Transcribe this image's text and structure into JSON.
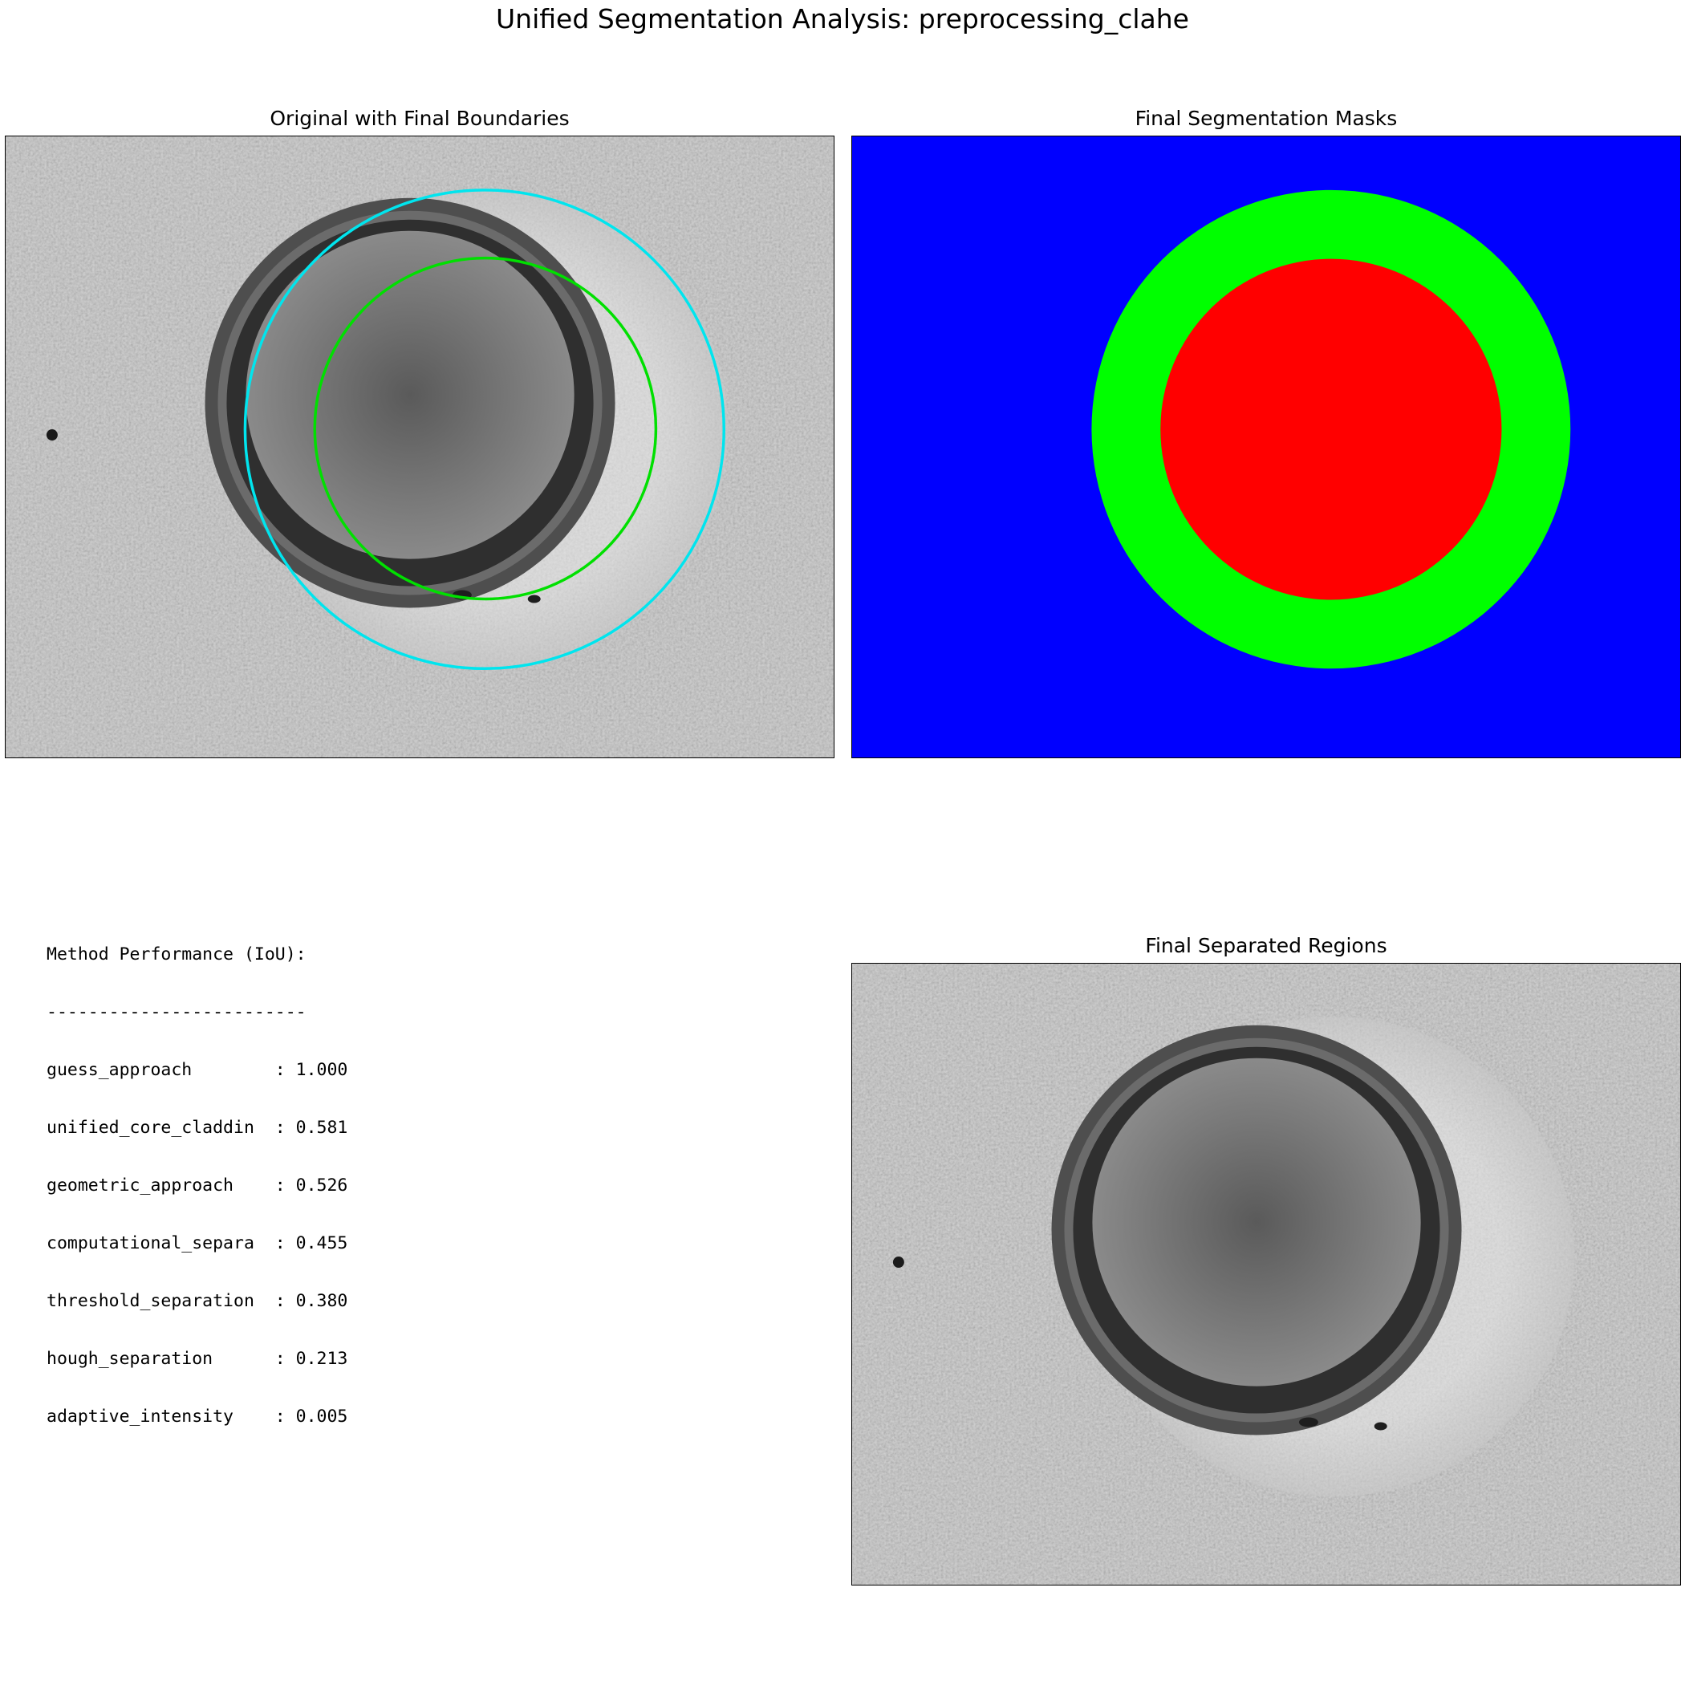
{
  "figure": {
    "suptitle": "Unified Segmentation Analysis: preprocessing_clahe"
  },
  "panels": {
    "original": {
      "title": "Original with Final Boundaries"
    },
    "masks": {
      "title": "Final Segmentation Masks"
    },
    "regions": {
      "title": "Final Separated Regions"
    }
  },
  "colors": {
    "cladding_boundary": "#00e5ee",
    "core_boundary": "#00e000",
    "mask_ferrule": "#0000ff",
    "mask_cladding": "#00ff00",
    "mask_core": "#ff0000"
  },
  "performance": {
    "heading": "Method Performance (IoU):",
    "separator": "-------------------------",
    "rows": [
      {
        "method": "guess_approach",
        "iou": "1.000",
        "line": "guess_approach        : 1.000"
      },
      {
        "method": "unified_core_claddin",
        "iou": "0.581",
        "line": "unified_core_claddin  : 0.581"
      },
      {
        "method": "geometric_approach",
        "iou": "0.526",
        "line": "geometric_approach    : 0.526"
      },
      {
        "method": "computational_separa",
        "iou": "0.455",
        "line": "computational_separa  : 0.455"
      },
      {
        "method": "threshold_separation",
        "iou": "0.380",
        "line": "threshold_separation  : 0.380"
      },
      {
        "method": "hough_separation",
        "iou": "0.213",
        "line": "hough_separation      : 0.213"
      },
      {
        "method": "adaptive_intensity",
        "iou": "0.005",
        "line": "adaptive_intensity    : 0.005"
      }
    ]
  }
}
